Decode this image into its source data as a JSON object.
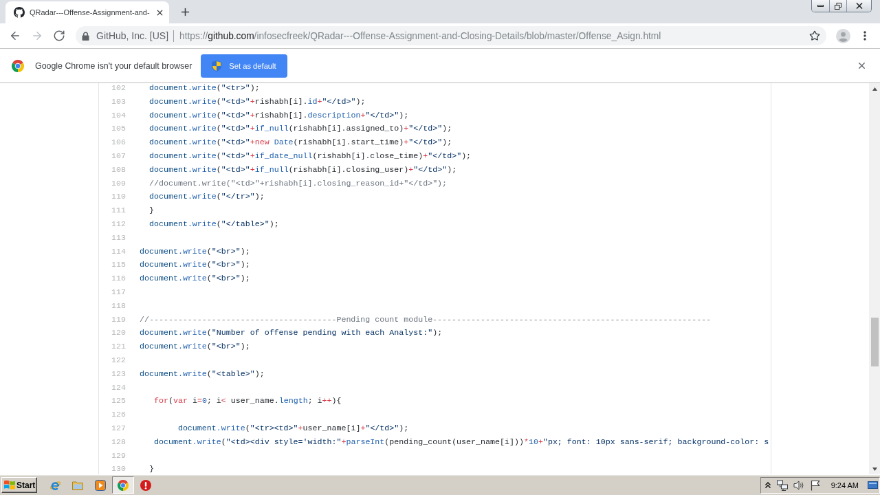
{
  "window": {
    "tabs": [
      {
        "title": "QRadar---Offense-Assignment-and-",
        "selected": true
      }
    ]
  },
  "toolbar": {
    "nav_buttons": [
      {
        "kind": "back",
        "disabled": false
      },
      {
        "kind": "forward",
        "disabled": true
      },
      {
        "kind": "reload",
        "disabled": false
      }
    ],
    "site_identity": "GitHub, Inc. [US]",
    "url": {
      "scheme": "https://",
      "host": "github.com",
      "path": "/infosecfreek/QRadar---Offense-Assignment-and-Closing-Details/blob/master/Offense_Asign.html"
    },
    "bookmarked": false
  },
  "infobar": {
    "message": "Google Chrome isn't your default browser",
    "button": "Set as default"
  },
  "code": {
    "lines": [
      {
        "number": "102",
        "tokens": [
          {
            "kind": "object",
            "text": "  document"
          },
          {
            "kind": "method",
            "text": ".write"
          },
          {
            "kind": "plain",
            "text": "("
          },
          {
            "kind": "string",
            "text": "\"<tr>\""
          },
          {
            "kind": "plain",
            "text": ");"
          }
        ]
      },
      {
        "number": "103",
        "tokens": [
          {
            "kind": "object",
            "text": "  document"
          },
          {
            "kind": "method",
            "text": ".write"
          },
          {
            "kind": "plain",
            "text": "("
          },
          {
            "kind": "string",
            "text": "\"<td>\""
          },
          {
            "kind": "keyword",
            "text": "+"
          },
          {
            "kind": "plain",
            "text": "rishabh[i]."
          },
          {
            "kind": "property",
            "text": "id"
          },
          {
            "kind": "keyword",
            "text": "+"
          },
          {
            "kind": "string",
            "text": "\"</td>\""
          },
          {
            "kind": "plain",
            "text": ");"
          }
        ]
      },
      {
        "number": "104",
        "tokens": [
          {
            "kind": "object",
            "text": "  document"
          },
          {
            "kind": "method",
            "text": ".write"
          },
          {
            "kind": "plain",
            "text": "("
          },
          {
            "kind": "string",
            "text": "\"<td>\""
          },
          {
            "kind": "keyword",
            "text": "+"
          },
          {
            "kind": "plain",
            "text": "rishabh[i]."
          },
          {
            "kind": "property",
            "text": "description"
          },
          {
            "kind": "keyword",
            "text": "+"
          },
          {
            "kind": "string",
            "text": "\"</td>\""
          },
          {
            "kind": "plain",
            "text": ");"
          }
        ]
      },
      {
        "number": "105",
        "tokens": [
          {
            "kind": "object",
            "text": "  document"
          },
          {
            "kind": "method",
            "text": ".write"
          },
          {
            "kind": "plain",
            "text": "("
          },
          {
            "kind": "string",
            "text": "\"<td>\""
          },
          {
            "kind": "keyword",
            "text": "+"
          },
          {
            "kind": "method",
            "text": "if_null"
          },
          {
            "kind": "plain",
            "text": "(rishabh[i].assigned_to)"
          },
          {
            "kind": "keyword",
            "text": "+"
          },
          {
            "kind": "string",
            "text": "\"</td>\""
          },
          {
            "kind": "plain",
            "text": ");"
          }
        ]
      },
      {
        "number": "106",
        "tokens": [
          {
            "kind": "object",
            "text": "  document"
          },
          {
            "kind": "method",
            "text": ".write"
          },
          {
            "kind": "plain",
            "text": "("
          },
          {
            "kind": "string",
            "text": "\"<td>\""
          },
          {
            "kind": "keyword",
            "text": "+new "
          },
          {
            "kind": "method",
            "text": "Date"
          },
          {
            "kind": "plain",
            "text": "(rishabh[i].start_time)"
          },
          {
            "kind": "keyword",
            "text": "+"
          },
          {
            "kind": "string",
            "text": "\"</td>\""
          },
          {
            "kind": "plain",
            "text": ");"
          }
        ]
      },
      {
        "number": "107",
        "tokens": [
          {
            "kind": "object",
            "text": "  document"
          },
          {
            "kind": "method",
            "text": ".write"
          },
          {
            "kind": "plain",
            "text": "("
          },
          {
            "kind": "string",
            "text": "\"<td>\""
          },
          {
            "kind": "keyword",
            "text": "+"
          },
          {
            "kind": "method",
            "text": "if_date_null"
          },
          {
            "kind": "plain",
            "text": "(rishabh[i].close_time)"
          },
          {
            "kind": "keyword",
            "text": "+"
          },
          {
            "kind": "string",
            "text": "\"</td>\""
          },
          {
            "kind": "plain",
            "text": ");"
          }
        ]
      },
      {
        "number": "108",
        "tokens": [
          {
            "kind": "object",
            "text": "  document"
          },
          {
            "kind": "method",
            "text": ".write"
          },
          {
            "kind": "plain",
            "text": "("
          },
          {
            "kind": "string",
            "text": "\"<td>\""
          },
          {
            "kind": "keyword",
            "text": "+"
          },
          {
            "kind": "method",
            "text": "if_null"
          },
          {
            "kind": "plain",
            "text": "(rishabh[i].closing_user)"
          },
          {
            "kind": "keyword",
            "text": "+"
          },
          {
            "kind": "string",
            "text": "\"</td>\""
          },
          {
            "kind": "plain",
            "text": ");"
          }
        ]
      },
      {
        "number": "109",
        "tokens": [
          {
            "kind": "comment",
            "text": "  //document.write(\"<td>\"+rishabh[i].closing_reason_id+\"</td>\");"
          }
        ]
      },
      {
        "number": "110",
        "tokens": [
          {
            "kind": "object",
            "text": "  document"
          },
          {
            "kind": "method",
            "text": ".write"
          },
          {
            "kind": "plain",
            "text": "("
          },
          {
            "kind": "string",
            "text": "\"</tr>\""
          },
          {
            "kind": "plain",
            "text": ");"
          }
        ]
      },
      {
        "number": "111",
        "tokens": [
          {
            "kind": "plain",
            "text": "  }"
          }
        ]
      },
      {
        "number": "112",
        "tokens": [
          {
            "kind": "object",
            "text": "  document"
          },
          {
            "kind": "method",
            "text": ".write"
          },
          {
            "kind": "plain",
            "text": "("
          },
          {
            "kind": "string",
            "text": "\"</table>\""
          },
          {
            "kind": "plain",
            "text": ");"
          }
        ]
      },
      {
        "number": "113"
      },
      {
        "number": "114",
        "tokens": [
          {
            "kind": "object",
            "text": "document"
          },
          {
            "kind": "method",
            "text": ".write"
          },
          {
            "kind": "plain",
            "text": "("
          },
          {
            "kind": "string",
            "text": "\"<br>\""
          },
          {
            "kind": "plain",
            "text": ");"
          }
        ]
      },
      {
        "number": "115",
        "tokens": [
          {
            "kind": "object",
            "text": "document"
          },
          {
            "kind": "method",
            "text": ".write"
          },
          {
            "kind": "plain",
            "text": "("
          },
          {
            "kind": "string",
            "text": "\"<br>\""
          },
          {
            "kind": "plain",
            "text": ");"
          }
        ]
      },
      {
        "number": "116",
        "tokens": [
          {
            "kind": "object",
            "text": "document"
          },
          {
            "kind": "method",
            "text": ".write"
          },
          {
            "kind": "plain",
            "text": "("
          },
          {
            "kind": "string",
            "text": "\"<br>\""
          },
          {
            "kind": "plain",
            "text": ");"
          }
        ]
      },
      {
        "number": "117"
      },
      {
        "number": "118"
      },
      {
        "number": "119",
        "tokens": [
          {
            "kind": "comment",
            "text": "//---------------------------------------Pending count module----------------------------------------------------------"
          }
        ]
      },
      {
        "number": "120",
        "tokens": [
          {
            "kind": "object",
            "text": "document"
          },
          {
            "kind": "method",
            "text": ".write"
          },
          {
            "kind": "plain",
            "text": "("
          },
          {
            "kind": "string",
            "text": "\"Number of offense pending with each Analyst:\""
          },
          {
            "kind": "plain",
            "text": ");"
          }
        ]
      },
      {
        "number": "121",
        "tokens": [
          {
            "kind": "object",
            "text": "document"
          },
          {
            "kind": "method",
            "text": ".write"
          },
          {
            "kind": "plain",
            "text": "("
          },
          {
            "kind": "string",
            "text": "\"<br>\""
          },
          {
            "kind": "plain",
            "text": ");"
          }
        ]
      },
      {
        "number": "122"
      },
      {
        "number": "123",
        "tokens": [
          {
            "kind": "object",
            "text": "document"
          },
          {
            "kind": "method",
            "text": ".write"
          },
          {
            "kind": "plain",
            "text": "("
          },
          {
            "kind": "string",
            "text": "\"<table>\""
          },
          {
            "kind": "plain",
            "text": ");"
          }
        ]
      },
      {
        "number": "124"
      },
      {
        "number": "125",
        "tokens": [
          {
            "kind": "keyword",
            "text": "   for"
          },
          {
            "kind": "plain",
            "text": "("
          },
          {
            "kind": "keyword",
            "text": "var"
          },
          {
            "kind": "plain",
            "text": " i"
          },
          {
            "kind": "keyword",
            "text": "="
          },
          {
            "kind": "number",
            "text": "0"
          },
          {
            "kind": "plain",
            "text": "; i"
          },
          {
            "kind": "keyword",
            "text": "<"
          },
          {
            "kind": "plain",
            "text": " user_name."
          },
          {
            "kind": "property",
            "text": "length"
          },
          {
            "kind": "plain",
            "text": "; i"
          },
          {
            "kind": "keyword",
            "text": "++"
          },
          {
            "kind": "plain",
            "text": "){"
          }
        ]
      },
      {
        "number": "126"
      },
      {
        "number": "127",
        "tokens": [
          {
            "kind": "object",
            "text": "        document"
          },
          {
            "kind": "method",
            "text": ".write"
          },
          {
            "kind": "plain",
            "text": "("
          },
          {
            "kind": "string",
            "text": "\"<tr><td>\""
          },
          {
            "kind": "keyword",
            "text": "+"
          },
          {
            "kind": "plain",
            "text": "user_name[i]"
          },
          {
            "kind": "keyword",
            "text": "+"
          },
          {
            "kind": "string",
            "text": "\"</td>\""
          },
          {
            "kind": "plain",
            "text": ");"
          }
        ]
      },
      {
        "number": "128",
        "tokens": [
          {
            "kind": "object",
            "text": "   document"
          },
          {
            "kind": "method",
            "text": ".write"
          },
          {
            "kind": "plain",
            "text": "("
          },
          {
            "kind": "string",
            "text": "\"<td><div style='width:\""
          },
          {
            "kind": "keyword",
            "text": "+"
          },
          {
            "kind": "method",
            "text": "parseInt"
          },
          {
            "kind": "plain",
            "text": "(pending_count(user_name[i]))"
          },
          {
            "kind": "keyword",
            "text": "*"
          },
          {
            "kind": "number",
            "text": "10"
          },
          {
            "kind": "keyword",
            "text": "+"
          },
          {
            "kind": "string",
            "text": "\"px; font: 10px sans-serif; background-color: s"
          }
        ]
      },
      {
        "number": "129"
      },
      {
        "number": "130",
        "tokens": [
          {
            "kind": "plain",
            "text": "  }"
          }
        ]
      }
    ]
  },
  "taskbar": {
    "start": "Start",
    "apps": [
      {
        "selected": false
      },
      {
        "selected": false
      },
      {
        "selected": false
      },
      {
        "selected": true
      },
      {
        "selected": false
      }
    ],
    "clock": "9:24 AM"
  }
}
